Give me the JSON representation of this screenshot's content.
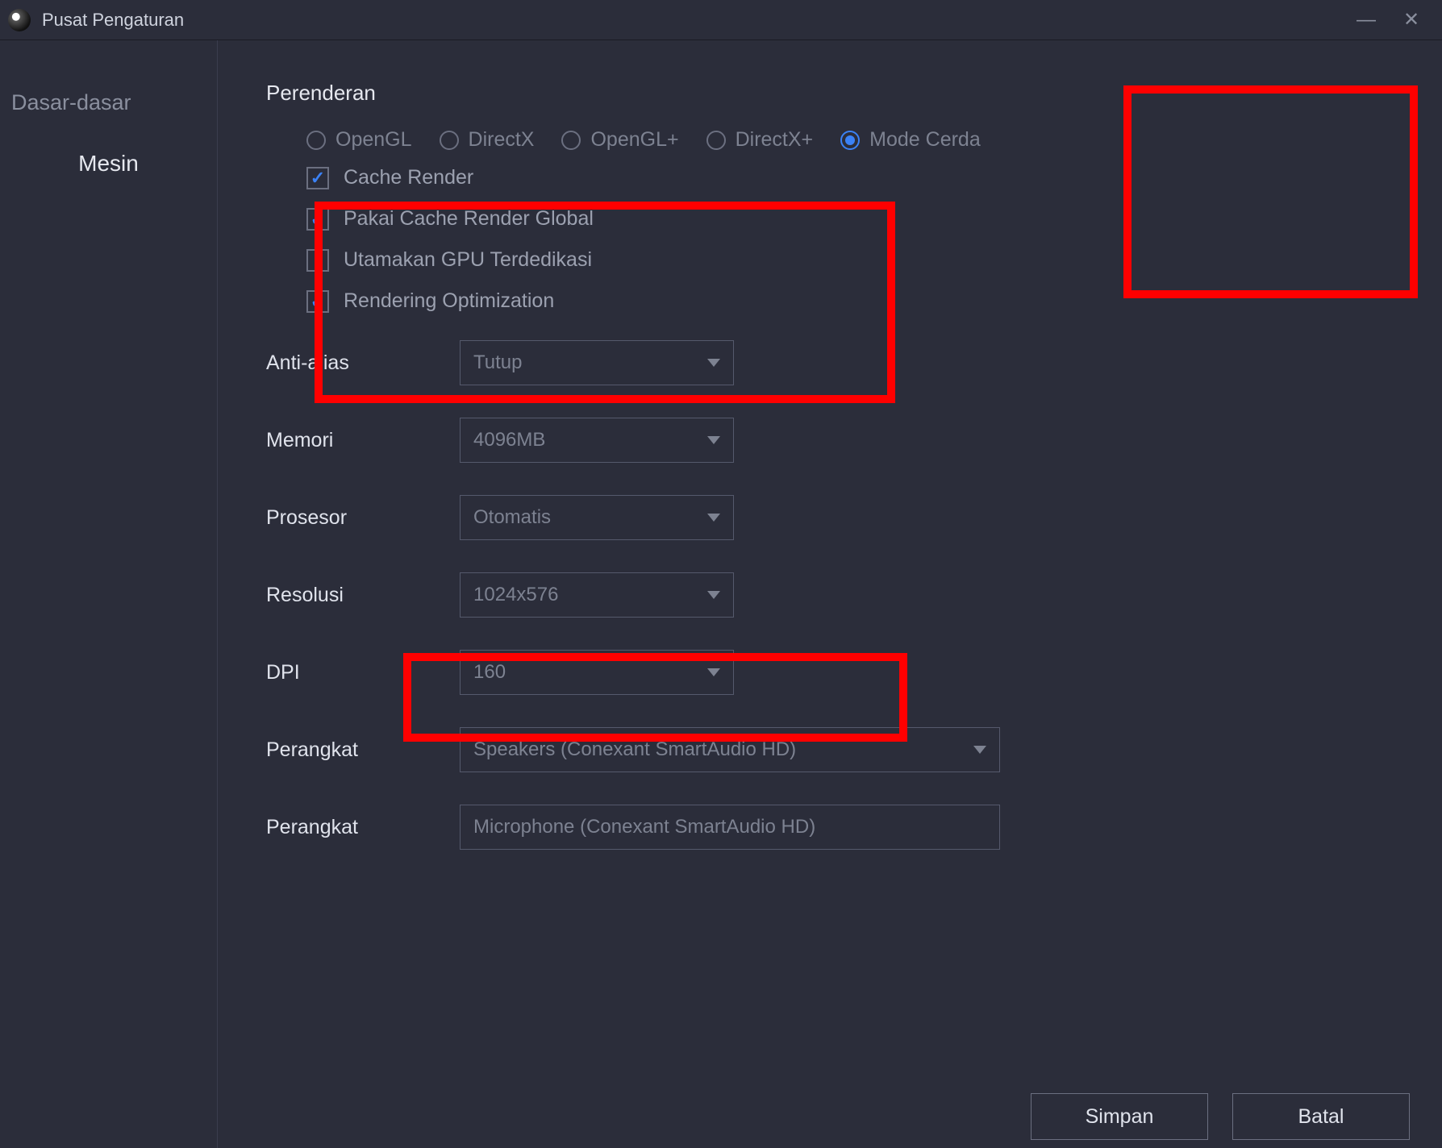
{
  "titlebar": {
    "title": "Pusat Pengaturan"
  },
  "sidebar": {
    "items": [
      {
        "label": "Dasar-dasar",
        "active": false
      },
      {
        "label": "Mesin",
        "active": true
      }
    ]
  },
  "rendering": {
    "section_title": "Perenderan",
    "modes": [
      {
        "label": "OpenGL",
        "selected": false
      },
      {
        "label": "DirectX",
        "selected": false
      },
      {
        "label": "OpenGL+",
        "selected": false
      },
      {
        "label": "DirectX+",
        "selected": false
      },
      {
        "label": "Mode Cerda",
        "selected": true
      }
    ],
    "checks": [
      {
        "label": "Cache Render",
        "checked": true
      },
      {
        "label": "Pakai Cache Render Global",
        "checked": true
      },
      {
        "label": "Utamakan GPU Terdedikasi",
        "checked": false
      },
      {
        "label": "Rendering Optimization",
        "checked": true
      }
    ]
  },
  "fields": {
    "antialias": {
      "label": "Anti-alias",
      "value": "Tutup"
    },
    "memory": {
      "label": "Memori",
      "value": "4096MB"
    },
    "processor": {
      "label": "Prosesor",
      "value": "Otomatis"
    },
    "resolution": {
      "label": "Resolusi",
      "value": "1024x576"
    },
    "dpi": {
      "label": "DPI",
      "value": "160"
    },
    "device_out": {
      "label": "Perangkat",
      "value": "Speakers (Conexant SmartAudio HD)"
    },
    "device_in": {
      "label": "Perangkat",
      "value": "Microphone (Conexant SmartAudio HD)"
    }
  },
  "footer": {
    "save": "Simpan",
    "cancel": "Batal"
  }
}
